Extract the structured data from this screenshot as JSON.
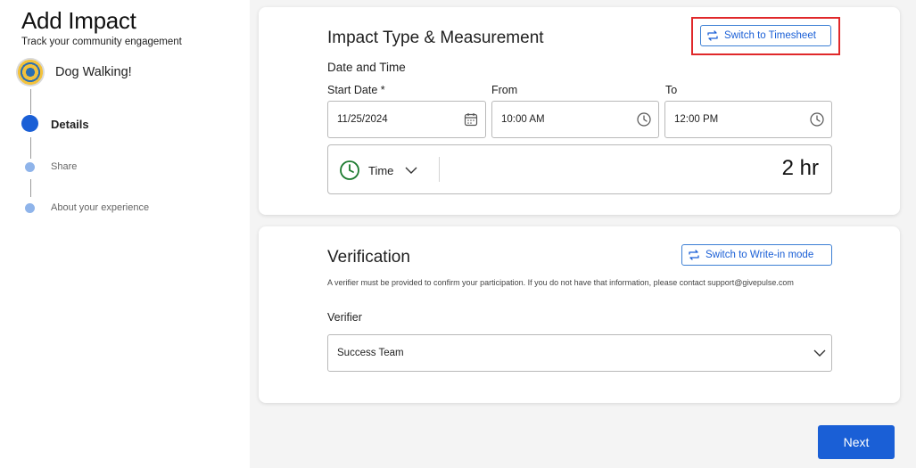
{
  "sidebar": {
    "title": "Add Impact",
    "subtitle": "Track your community engagement",
    "org_name": "Dog Walking!",
    "steps": [
      {
        "label": "Details",
        "active": true
      },
      {
        "label": "Share",
        "active": false
      },
      {
        "label": "About your experience",
        "active": false
      }
    ]
  },
  "impact": {
    "title": "Impact Type & Measurement",
    "switch_label": "Switch to Timesheet",
    "section_label": "Date and Time",
    "start_date_label": "Start Date *",
    "start_date_value": "11/25/2024",
    "from_label": "From",
    "from_value": "10:00 AM",
    "to_label": "To",
    "to_value": "12:00 PM",
    "unit_label": "Time",
    "duration_value": "2 hr"
  },
  "verification": {
    "title": "Verification",
    "switch_label": "Switch to Write-in mode",
    "description": "A verifier must be provided to confirm your participation. If you do not have that information, please contact support@givepulse.com",
    "verifier_label": "Verifier",
    "verifier_value": "Success Team"
  },
  "footer": {
    "next_label": "Next"
  },
  "colors": {
    "accent": "#1a5fd6",
    "highlight": "#e0282a",
    "clock_green": "#1b7a2e"
  }
}
